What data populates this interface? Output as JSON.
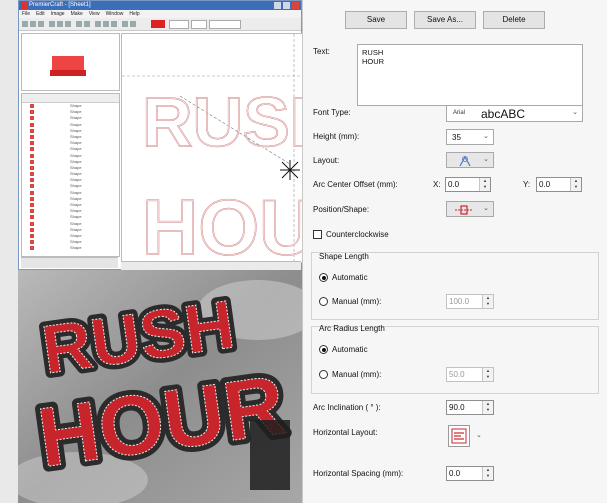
{
  "app_window": {
    "title": "PremierCraft - [Sheet1]",
    "menu": [
      "File",
      "Edit",
      "Image",
      "Make",
      "View",
      "Window",
      "Help"
    ]
  },
  "canvas": {
    "line1": "RUSH",
    "line2": "HOUR"
  },
  "photo": {
    "line1": "RUSH",
    "line2": "HOUR"
  },
  "panel": {
    "save_label": "Save",
    "save_as_label": "Save As...",
    "delete_label": "Delete",
    "text_label": "Text:",
    "text_line1": "RUSH",
    "text_line2": "HOUR",
    "font_type_label": "Font Type:",
    "font_name": "Arial",
    "font_sample": "abcABC",
    "height_label": "Height (mm):",
    "height_value": "35",
    "layout_label": "Layout:",
    "arc_offset_label": "Arc Center Offset (mm):",
    "x_label": "X:",
    "x_value": "0.0",
    "y_label": "Y:",
    "y_value": "0.0",
    "position_shape_label": "Position/Shape:",
    "counterclockwise_label": "Counterclockwise",
    "shape_length_label": "Shape Length",
    "automatic_label": "Automatic",
    "manual_label": "Manual (mm):",
    "shape_manual_value": "100.0",
    "arc_radius_label": "Arc Radius Length",
    "radius_manual_value": "50.0",
    "arc_inclination_label": "Arc Inclination ( ° ):",
    "arc_inclination_value": "90.0",
    "horizontal_layout_label": "Horizontal Layout:",
    "horizontal_spacing_label": "Horizontal Spacing (mm):",
    "horizontal_spacing_value": "0.0"
  },
  "colors": {
    "accent_red": "#c8242b",
    "title_blue": "#3c6fb8"
  },
  "icons": {
    "layout": "arc-layout-icon",
    "position_shape": "shape-position-icon",
    "horizontal_layout": "text-align-icon"
  }
}
